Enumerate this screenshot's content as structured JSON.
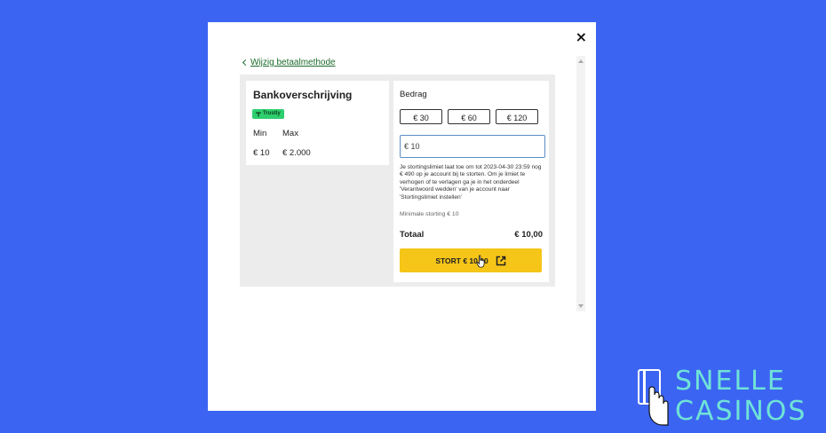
{
  "modal": {
    "close_glyph": "×",
    "back_link": "Wijzig betaalmethode"
  },
  "method": {
    "title": "Bankoverschrijving",
    "provider_badge": "Trustly",
    "min_label": "Min",
    "max_label": "Max",
    "min_value": "€ 10",
    "max_value": "€ 2.000"
  },
  "deposit": {
    "amount_label": "Bedrag",
    "presets": [
      "€ 30",
      "€ 60",
      "€ 120"
    ],
    "input_value": "€ 10",
    "notice": "Je stortingslimiet laat toe om tot 2023-04-30 23:59 nog € 490 op je account bij te storten. Om je limiet te verhogen of te verlagen ga je in het onderdeel 'Verantwoord wedden' van je account naar 'Stortingslimiet instellen'",
    "minimum_note": "Minimale storting € 10",
    "total_label": "Totaal",
    "total_value": "€ 10,00",
    "button_label": "STORT € 10,00"
  },
  "brand": {
    "line1": "SNELLE",
    "line2": "CASINOS"
  },
  "colors": {
    "background": "#3c64f2",
    "cta": "#f5c518",
    "link": "#1c6b2c",
    "badge": "#2ecf6e",
    "logo": "#6fe3d7"
  },
  "icons": [
    "close-icon",
    "chevron-left-icon",
    "external-link-icon",
    "hand-cursor-icon",
    "card-hand-logo-icon"
  ]
}
